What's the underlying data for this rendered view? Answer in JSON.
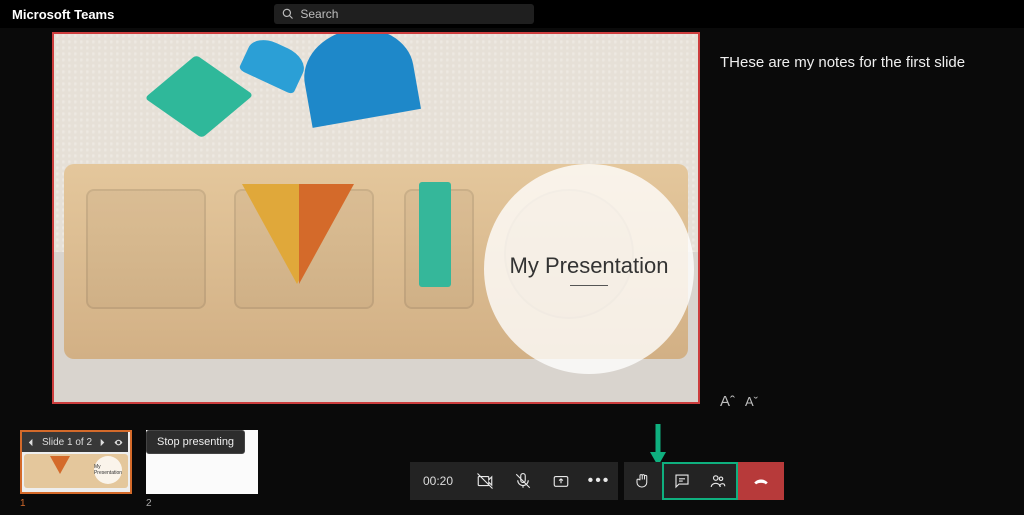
{
  "app_title": "Microsoft Teams",
  "search_placeholder": "Search",
  "slide": {
    "title": "My Presentation"
  },
  "notes": {
    "text": "THese are my notes for the first slide",
    "font_increase_label": "Aˆ",
    "font_decrease_label": "Aˇ"
  },
  "presenter": {
    "slide_counter": "Slide 1 of 2",
    "thumb_numbers": [
      "1",
      "2"
    ],
    "thumb_presentation_label": "My Presentation",
    "stop_label": "Stop presenting"
  },
  "call": {
    "duration": "00:20",
    "ellipsis": "•••"
  },
  "colors": {
    "slide_border": "#cc3d3d",
    "highlight_green": "#0fb07f",
    "end_call_red": "#b73a3a"
  }
}
